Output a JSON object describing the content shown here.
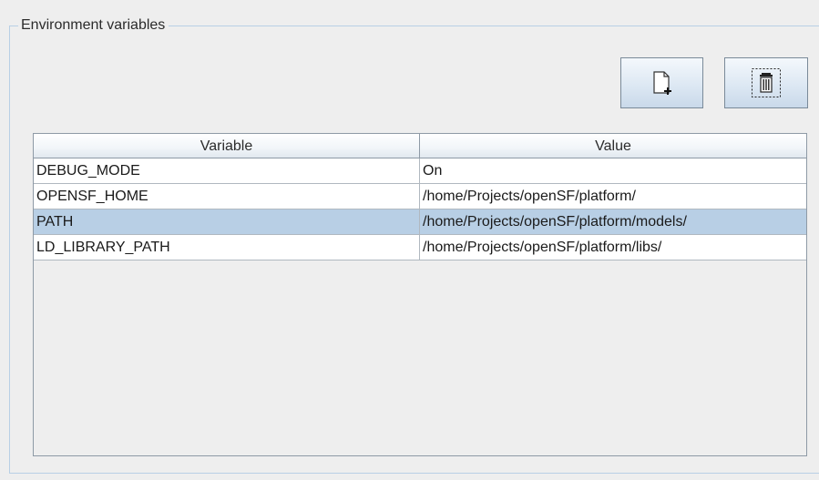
{
  "panel": {
    "title": "Environment variables"
  },
  "toolbar": {
    "add_icon": "new-file-icon",
    "delete_icon": "trash-icon"
  },
  "table": {
    "columns": [
      "Variable",
      "Value"
    ],
    "rows": [
      {
        "variable": "DEBUG_MODE",
        "value": "On",
        "selected": false
      },
      {
        "variable": "OPENSF_HOME",
        "value": "/home/Projects/openSF/platform/",
        "selected": false
      },
      {
        "variable": "PATH",
        "value": "/home/Projects/openSF/platform/models/",
        "selected": true
      },
      {
        "variable": "LD_LIBRARY_PATH",
        "value": "/home/Projects/openSF/platform/libs/",
        "selected": false
      }
    ]
  },
  "colors": {
    "background": "#eeeeee",
    "selection": "#b8cfe5",
    "border": "#8e9aa6"
  }
}
